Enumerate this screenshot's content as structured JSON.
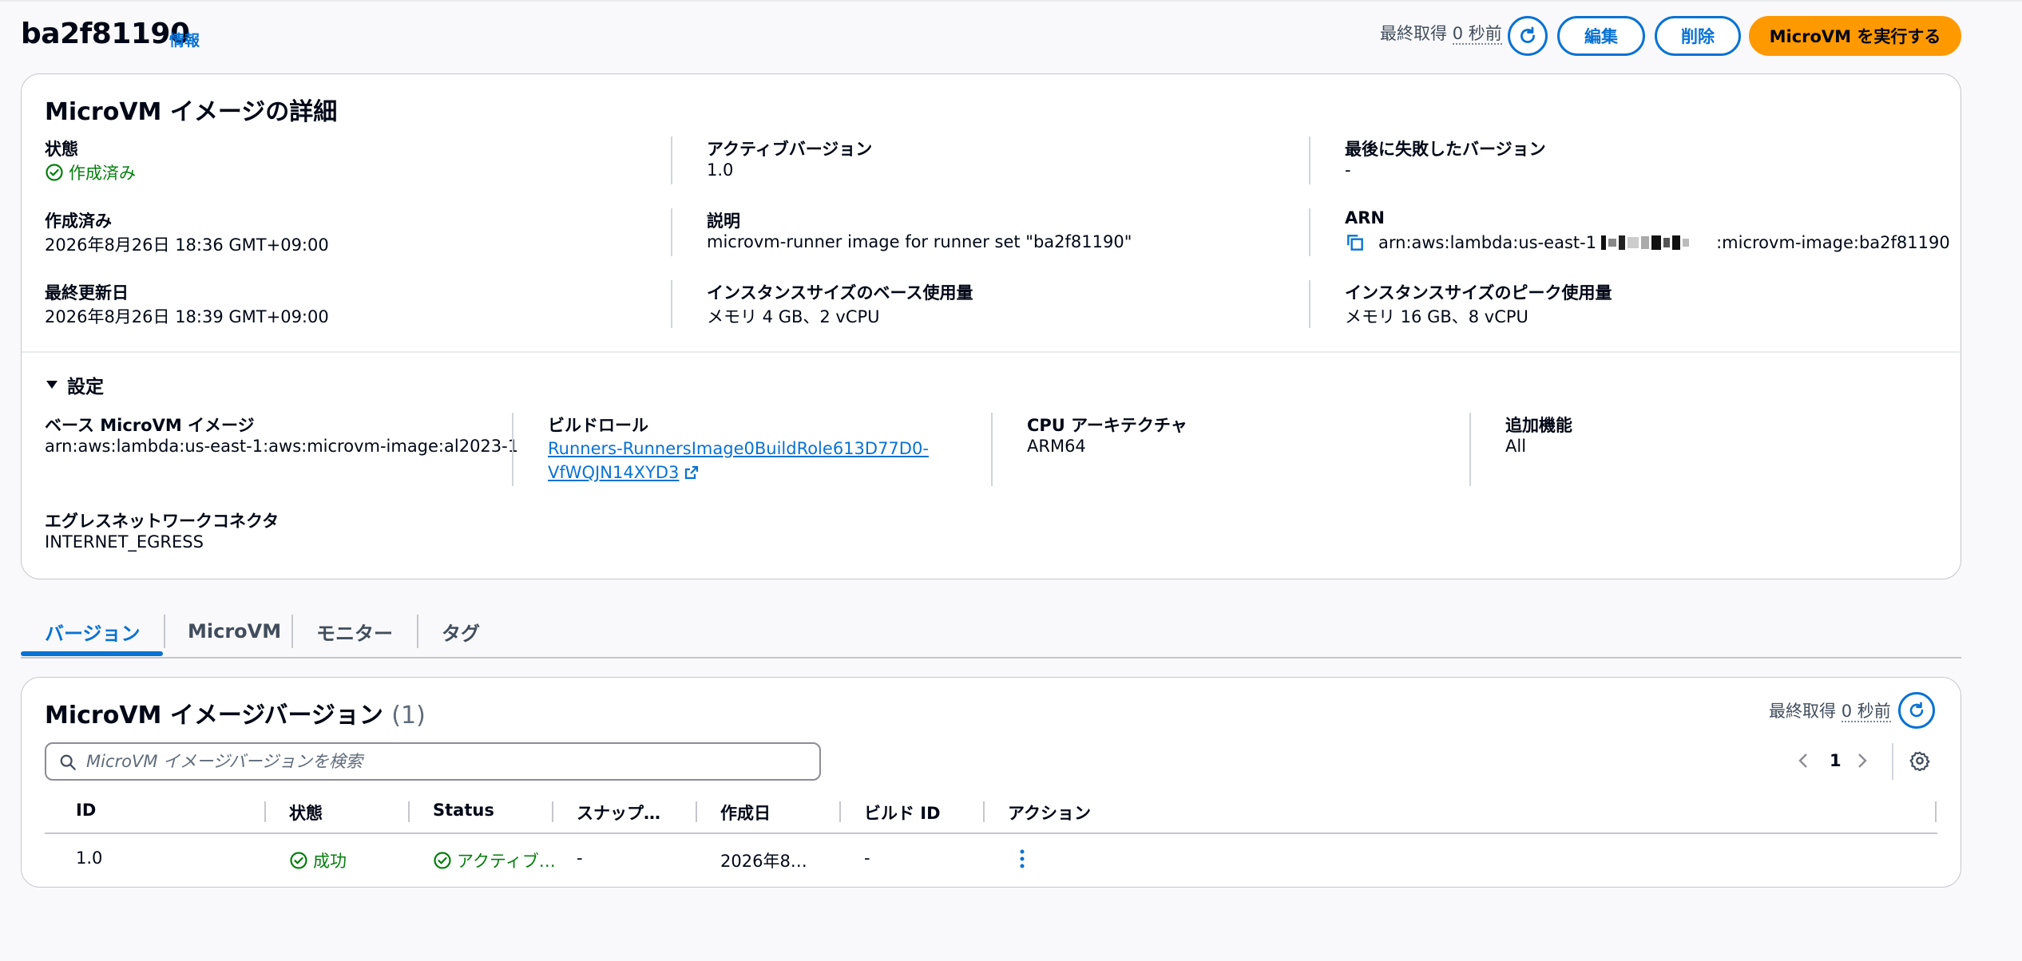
{
  "header": {
    "title": "ba2f81190",
    "info_link": "情報",
    "last_fetched_prefix": "最終取得",
    "last_fetched_value": "0 秒前",
    "edit_label": "編集",
    "delete_label": "削除",
    "run_label": "MicroVM を実行する"
  },
  "details": {
    "heading": "MicroVM イメージの詳細",
    "status_label": "状態",
    "status_value": "作成済み",
    "active_version_label": "アクティブバージョン",
    "active_version_value": "1.0",
    "last_failed_label": "最後に失敗したバージョン",
    "last_failed_value": "-",
    "created_label": "作成済み",
    "created_value": "2026年8月26日 18:36 GMT+09:00",
    "description_label": "説明",
    "description_value": "microvm-runner image for runner set \"ba2f81190\"",
    "arn_label": "ARN",
    "arn_prefix": "arn:aws:lambda:us-east-1",
    "arn_suffix": ":microvm-image:ba2f81190",
    "updated_label": "最終更新日",
    "updated_value": "2026年8月26日 18:39 GMT+09:00",
    "base_usage_label": "インスタンスサイズのベース使用量",
    "base_usage_value": "メモリ 4 GB、2 vCPU",
    "peak_usage_label": "インスタンスサイズのピーク使用量",
    "peak_usage_value": "メモリ 16 GB、8 vCPU"
  },
  "settings": {
    "heading": "設定",
    "base_image_label": "ベース MicroVM イメージ",
    "base_image_value": "arn:aws:lambda:us-east-1:aws:microvm-image:al2023-1",
    "build_role_label": "ビルドロール",
    "build_role_line1": "Runners-RunnersImage0BuildRole613D77D0-",
    "build_role_line2": "VfWQJN14XYD3",
    "cpu_arch_label": "CPU アーキテクチャ",
    "cpu_arch_value": "ARM64",
    "extra_label": "追加機能",
    "extra_value": "All",
    "egress_label": "エグレスネットワークコネクタ",
    "egress_value": "INTERNET_EGRESS"
  },
  "tabs": [
    {
      "label": "バージョン"
    },
    {
      "label": "MicroVM"
    },
    {
      "label": "モニター"
    },
    {
      "label": "タグ"
    }
  ],
  "versions": {
    "heading": "MicroVM イメージバージョン",
    "count": "(1)",
    "last_fetched_prefix": "最終取得",
    "last_fetched_value": "0 秒前",
    "search_placeholder": "MicroVM イメージバージョンを検索",
    "page": "1",
    "columns": [
      "ID",
      "状態",
      "Status",
      "スナップ…",
      "作成日",
      "ビルド ID",
      "アクション"
    ],
    "rows": [
      {
        "id": "1.0",
        "state": "成功",
        "status": "アクティブ…",
        "snapshot": "-",
        "created": "2026年8…",
        "build_id": "-"
      }
    ]
  },
  "colors": {
    "accent": "#0972d3",
    "primary_button": "#ff9900",
    "success": "#037f0c"
  }
}
